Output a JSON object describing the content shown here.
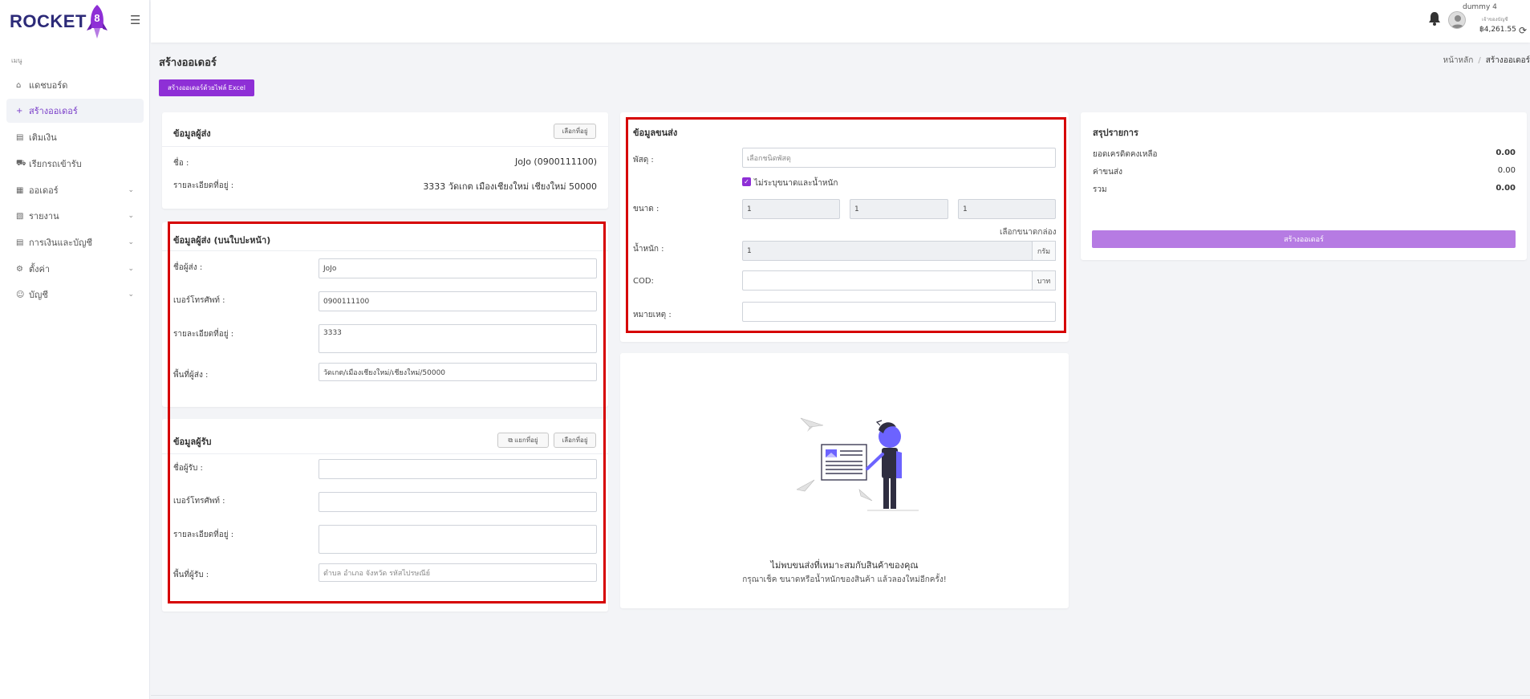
{
  "brand": {
    "name": "ROCKET",
    "number": "8"
  },
  "sidebar": {
    "menu_title": "เมนู",
    "items": [
      {
        "label": "แดชบอร์ด"
      },
      {
        "label": "สร้างออเดอร์"
      },
      {
        "label": "เติมเงิน"
      },
      {
        "label": "เรียกรถเข้ารับ"
      },
      {
        "label": "ออเดอร์"
      },
      {
        "label": "รายงาน"
      },
      {
        "label": "การเงินและบัญชี"
      },
      {
        "label": "ตั้งค่า"
      },
      {
        "label": "บัญชี"
      }
    ]
  },
  "topbar": {
    "user_name": "dummy 4",
    "user_sub": "เจ้าของบัญชี",
    "balance": "฿4,261.55"
  },
  "page": {
    "title": "สร้างออเดอร์",
    "breadcrumb": [
      "หน้าหลัก",
      "/",
      "สร้างออเดอร์"
    ],
    "excel_button": "สร้างออเดอร์ด้วยไฟล์ Excel"
  },
  "sender_info": {
    "title": "ข้อมูลผู้ส่ง",
    "select_button": "เลือกที่อยู่",
    "name_label": "ชื่อ :",
    "name_value": "JoJo (0900111100)",
    "address_label": "รายละเอียดที่อยู่ :",
    "address_value": "3333 วัดเกต เมืองเชียงใหม่ เชียงใหม่ 50000"
  },
  "sender_label": {
    "title": "ข้อมูลผู้ส่ง (บนใบปะหน้า)",
    "fields": [
      {
        "label": "ชื่อผู้ส่ง :",
        "value": "JoJo"
      },
      {
        "label": "เบอร์โทรศัพท์ :",
        "value": "0900111100"
      },
      {
        "label": "รายละเอียดที่อยู่ :",
        "value": "3333"
      },
      {
        "label": "พื้นที่ผู้ส่ง :",
        "value": "วัดเกต/เมืองเชียงใหม่/เชียงใหม่/50000"
      }
    ]
  },
  "receiver": {
    "title": "ข้อมูลผู้รับ",
    "split_button": "แยกที่อยู่",
    "select_button": "เลือกที่อยู่",
    "fields": [
      {
        "label": "ชื่อผู้รับ :",
        "value": ""
      },
      {
        "label": "เบอร์โทรศัพท์ :",
        "value": ""
      },
      {
        "label": "รายละเอียดที่อยู่ :",
        "value": ""
      },
      {
        "label": "พื้นที่ผู้รับ :",
        "placeholder": "ตำบล อำเภอ จังหวัด รหัสไปรษณีย์"
      }
    ]
  },
  "shipping": {
    "title": "ข้อมูลขนส่ง",
    "parcel_label": "พัสดุ :",
    "parcel_placeholder": "เลือกชนิดพัสดุ",
    "unspecified_label": "ไม่ระบุขนาดและน้ำหนัก",
    "size_label": "ขนาด :",
    "size_values": [
      "1",
      "1",
      "1"
    ],
    "box_link": "เลือกขนาดกล่อง",
    "weight_label": "น้ำหนัก :",
    "weight_value": "1",
    "weight_unit": "กรัม",
    "cod_label": "COD:",
    "cod_value": "",
    "cod_unit": "บาท",
    "note_label": "หมายเหตุ :",
    "note_value": ""
  },
  "empty_state": {
    "message": "ไม่พบขนส่งที่เหมาะสมกับสินค้าของคุณ",
    "hint": "กรุณาเช็ค ขนาดหรือน้ำหนักของสินค้า แล้วลองใหม่อีกครั้ง!"
  },
  "summary": {
    "title": "สรุปรายการ",
    "rows": [
      {
        "label": "ยอดเครดิตคงเหลือ",
        "value": "0.00"
      },
      {
        "label": "ค่าขนส่ง",
        "value": "0.00"
      },
      {
        "label": "รวม",
        "value": "0.00"
      }
    ],
    "create_button": "สร้างออเดอร์"
  },
  "colors": {
    "brand": "#8e2fd6",
    "highlight_border": "#d60000",
    "primary_disabled": "#b67be3",
    "logo_dark": "#2c2a78"
  }
}
